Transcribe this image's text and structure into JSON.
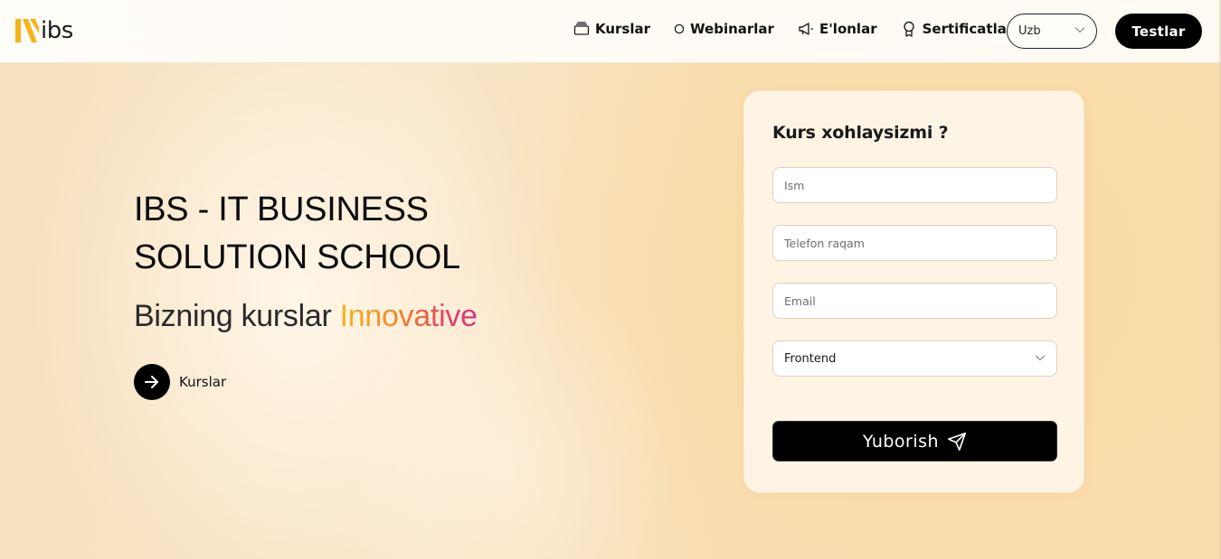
{
  "header": {
    "logo_text": "ibs",
    "nav": [
      {
        "label": "Kurslar",
        "icon": "folder-icon"
      },
      {
        "label": "Webinarlar",
        "icon": "circle-icon"
      },
      {
        "label": "E'lonlar",
        "icon": "megaphone-icon"
      },
      {
        "label": "Sertificatlar",
        "icon": "award-icon"
      }
    ],
    "language": {
      "selected": "Uzb"
    },
    "tests_button": "Testlar"
  },
  "hero": {
    "title_line1": "IBS - IT BUSINESS",
    "title_line2": "SOLUTION SCHOOL",
    "subtitle_prefix": "Bizning kurslar",
    "subtitle_accent": "Innovative",
    "cta_label": "Kurslar"
  },
  "form": {
    "title": "Kurs xohlaysizmi ?",
    "name_placeholder": "Ism",
    "phone_placeholder": "Telefon raqam",
    "email_placeholder": "Email",
    "course_selected": "Frontend",
    "submit_label": "Yuborish"
  },
  "colors": {
    "brand_yellow": "#f4b41a",
    "accent_gradient_start": "#f5b51e",
    "accent_gradient_end": "#d3348a",
    "button_black": "#000000",
    "card_bg": "#fdf4e4"
  }
}
